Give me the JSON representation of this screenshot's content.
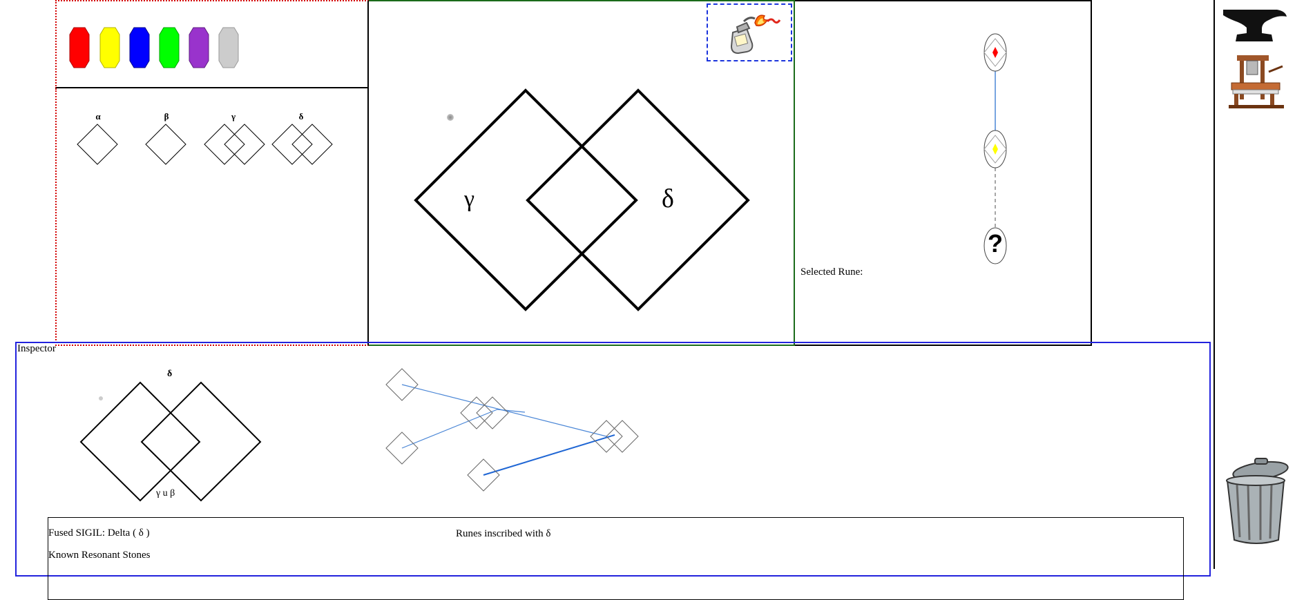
{
  "colors": {
    "gem_red": "#ff0000",
    "gem_yellow": "#ffff00",
    "gem_blue": "#0000ff",
    "gem_green": "#00ff00",
    "gem_purple": "#9933cc",
    "gem_grey": "#cccccc",
    "link_blue": "#4a86d6",
    "panel_blue": "#2222dd",
    "panel_green": "#1a6b1a",
    "panel_red_dotted": "#d40000"
  },
  "palette": {
    "gems": [
      "red-gem",
      "yellow-gem",
      "blue-gem",
      "green-gem",
      "purple-gem",
      "grey-gem"
    ]
  },
  "rune_list": {
    "runes": [
      {
        "label": "α"
      },
      {
        "label": "β"
      },
      {
        "label": "γ"
      },
      {
        "label": "δ"
      }
    ]
  },
  "canvas": {
    "left_rune_label": "γ",
    "right_rune_label": "δ",
    "tool_icon": "fire-spray-icon"
  },
  "lineage": {
    "selected_label": "Selected Rune:",
    "unknown_glyph": "?"
  },
  "inspector": {
    "title": "Inspector",
    "preview_label": "δ",
    "preview_formula": "γ u β",
    "fused_sigil": "Fused SIGIL: Delta ( δ )",
    "known_stones": "Known Resonant Stones",
    "runes_inscribed": "Runes inscribed with δ"
  },
  "tools": {
    "anvil": "anvil-icon",
    "press": "printing-press-icon",
    "trash": "trash-can-icon"
  }
}
